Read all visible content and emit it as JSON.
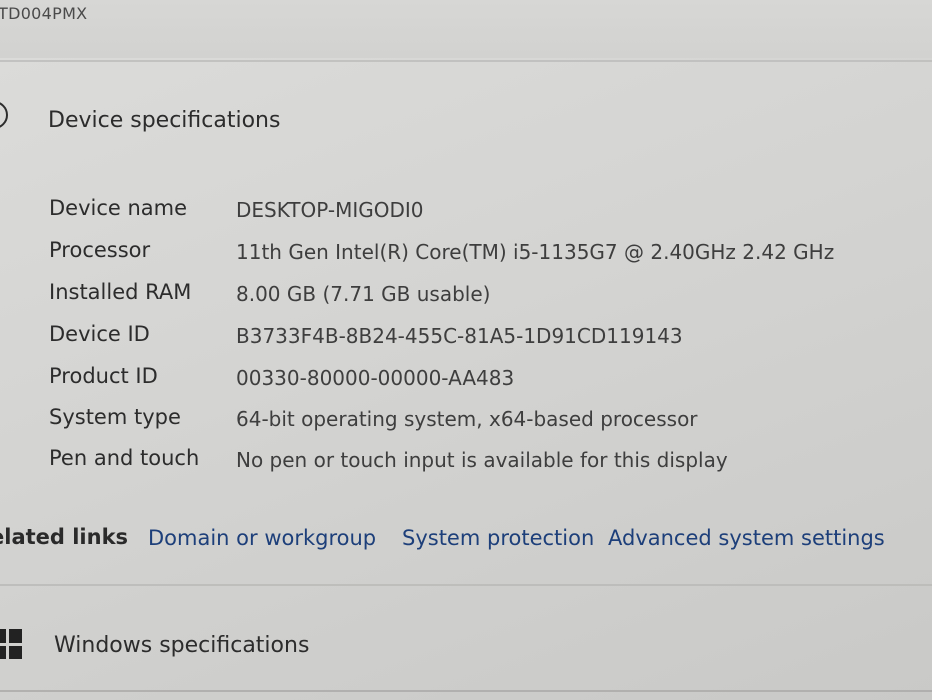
{
  "header": {
    "device_code": "TD004PMX"
  },
  "device_specifications": {
    "title": "Device specifications",
    "rows": [
      {
        "label": "Device name",
        "value": "DESKTOP-MIGODI0"
      },
      {
        "label": "Processor",
        "value": "11th Gen Intel(R) Core(TM) i5-1135G7 @ 2.40GHz   2.42 GHz"
      },
      {
        "label": "Installed RAM",
        "value": "8.00 GB (7.71 GB usable)"
      },
      {
        "label": "Device ID",
        "value": "B3733F4B-8B24-455C-81A5-1D91CD119143"
      },
      {
        "label": "Product ID",
        "value": "00330-80000-00000-AA483"
      },
      {
        "label": "System type",
        "value": "64-bit operating system, x64-based processor"
      },
      {
        "label": "Pen and touch",
        "value": "No pen or touch input is available for this display"
      }
    ]
  },
  "related_links": {
    "label": "elated links",
    "links": [
      "Domain or workgroup",
      "System protection",
      "Advanced system settings"
    ]
  },
  "windows_specifications": {
    "title": "Windows specifications"
  },
  "icons": {
    "device_specifications": "info-icon",
    "windows_specifications": "windows-logo-icon"
  },
  "colors": {
    "link": "#1d3f7a",
    "text": "#2c2c2c",
    "background": "#d6d6d4"
  }
}
